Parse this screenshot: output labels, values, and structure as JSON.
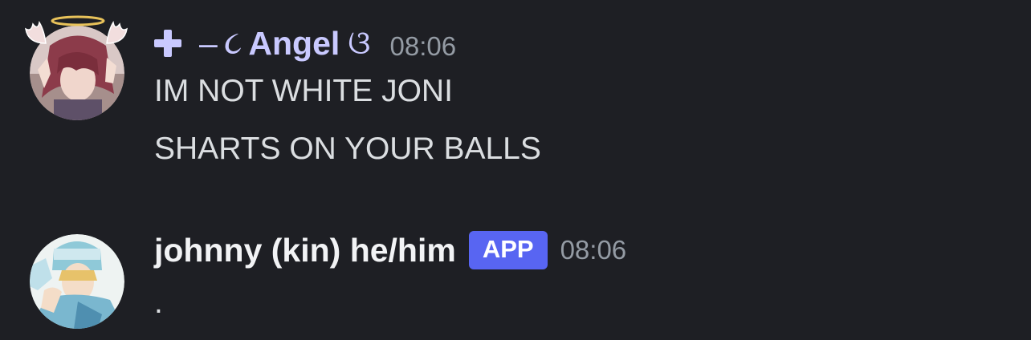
{
  "messages": [
    {
      "username_prefix": "–",
      "username_open": "૮",
      "username": "Angel",
      "username_close": "ଓ",
      "timestamp": "08:06",
      "lines": [
        "IM NOT WHITE JONI",
        "SHARTS ON YOUR BALLS"
      ],
      "username_color": "#c9c9ff"
    },
    {
      "username": "johnny (kin) he/him",
      "badge": "APP",
      "timestamp": "08:06",
      "lines": [
        "."
      ],
      "username_color": "#f2f3f5",
      "badge_color": "#5865f2"
    }
  ],
  "background": "#1e1f24"
}
